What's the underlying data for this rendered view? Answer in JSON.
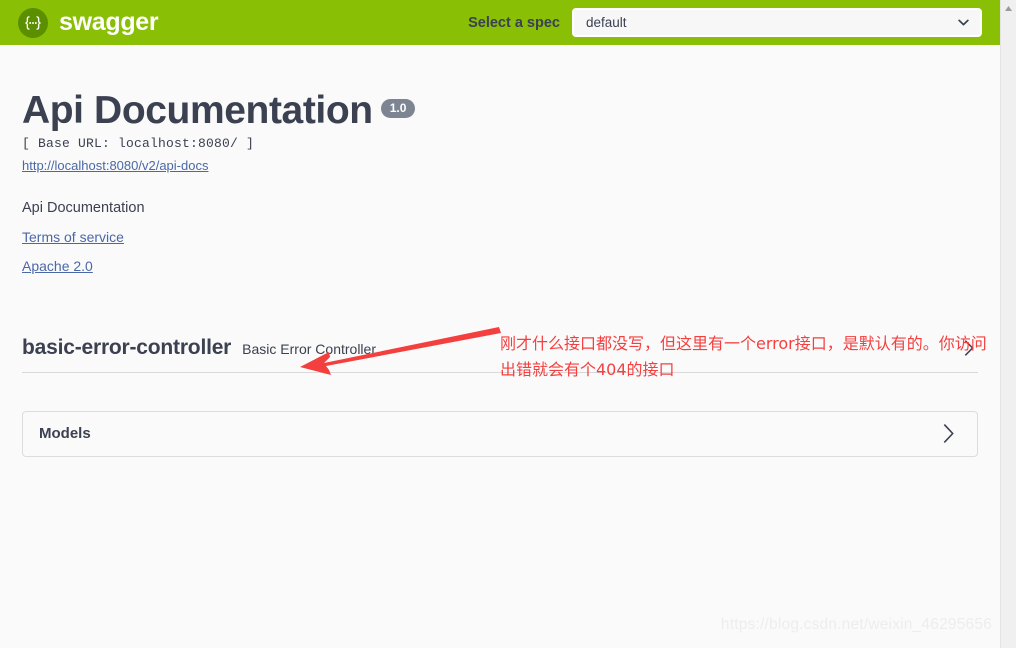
{
  "topbar": {
    "logo_icon": "swagger-braces-icon",
    "brand": "swagger",
    "spec_label": "Select a spec",
    "spec_selected": "default",
    "spec_options": [
      "default"
    ],
    "dropdown_icon": "chevron-down-icon",
    "background_color": "#89bf04"
  },
  "info": {
    "title": "Api Documentation",
    "version": "1.0",
    "base_url": "[ Base URL: localhost:8080/ ]",
    "docs_link": "http://localhost:8080/v2/api-docs",
    "description": "Api Documentation",
    "terms_link": "Terms of service",
    "license_link": "Apache 2.0"
  },
  "annotation": {
    "text": "刚才什么接口都没写，但这里有一个error接口，是默认有的。你访问出错就会有个404的接口",
    "color": "#f43f3f",
    "arrow_icon": "red-arrow-left-icon"
  },
  "tags": [
    {
      "name": "basic-error-controller",
      "description": "Basic Error Controller",
      "expand_icon": "chevron-right-icon"
    }
  ],
  "models": {
    "title": "Models",
    "expand_icon": "chevron-right-icon"
  },
  "watermark": "https://blog.csdn.net/weixin_46295656",
  "scrollbar": {
    "up_arrow_icon": "scroll-up-arrow-icon"
  }
}
